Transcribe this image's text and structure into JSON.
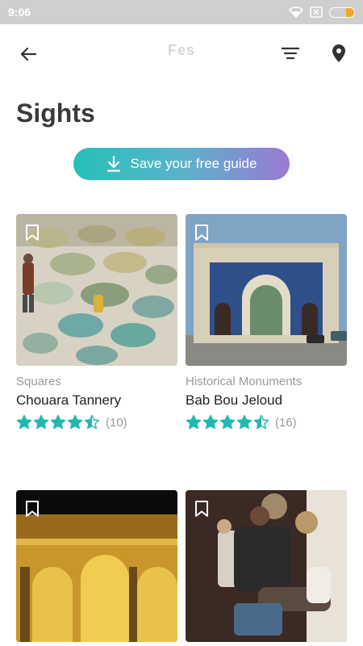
{
  "status": {
    "time": "9:06",
    "battery_level": 0.35,
    "battery_color": "#f5a623"
  },
  "toolbar": {
    "brand": "Fes",
    "back_icon": "arrow-left-icon",
    "filter_icon": "filter-icon",
    "map_icon": "map-pin-icon"
  },
  "page": {
    "title": "Sights"
  },
  "save_guide": {
    "label": "Save your free guide",
    "icon": "download-icon",
    "gradient": [
      "#25c0b8",
      "#9a79d4"
    ]
  },
  "colors": {
    "star": "#22b8b0"
  },
  "cards": [
    {
      "category": "Squares",
      "name": "Chouara Tannery",
      "rating": 4.5,
      "count": "(10)"
    },
    {
      "category": "Historical Monuments",
      "name": "Bab Bou Jeloud",
      "rating": 4.5,
      "count": "(16)"
    },
    {
      "category": "",
      "name": "",
      "rating": null,
      "count": ""
    },
    {
      "category": "",
      "name": "",
      "rating": null,
      "count": ""
    }
  ]
}
